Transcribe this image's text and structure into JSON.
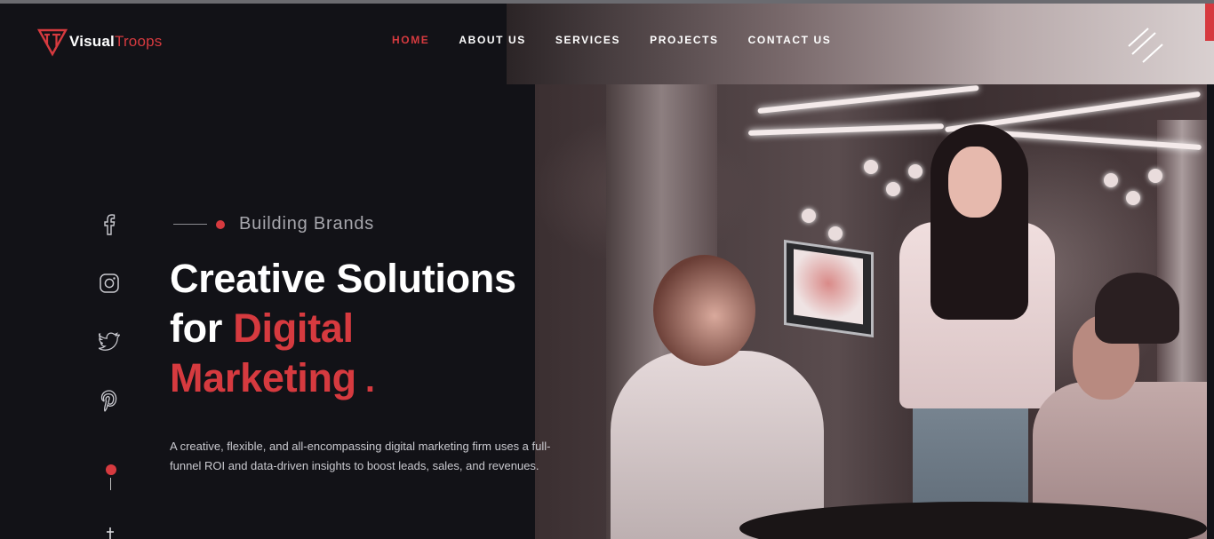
{
  "brand": {
    "name_part1": "Visual",
    "name_part2": "Troops"
  },
  "nav": {
    "items": [
      {
        "label": "HOME",
        "active": true
      },
      {
        "label": "ABOUT US",
        "active": false
      },
      {
        "label": "SERVICES",
        "active": false
      },
      {
        "label": "PROJECTS",
        "active": false
      },
      {
        "label": "CONTACT US",
        "active": false
      }
    ]
  },
  "hero": {
    "kicker": "Building Brands",
    "title_line1": "Creative Solutions",
    "title_line2_prefix": "for ",
    "title_line2_highlight": "Digital",
    "title_line3": "Marketing",
    "title_dot": ".",
    "description": "A creative, flexible, and all-encompassing digital marketing firm uses a full-funnel ROI and data-driven insights to boost leads, sales, and revenues."
  },
  "social": [
    {
      "icon": "facebook-icon"
    },
    {
      "icon": "instagram-icon"
    },
    {
      "icon": "twitter-icon"
    },
    {
      "icon": "pinterest-icon"
    }
  ],
  "colors": {
    "accent": "#d63a3f",
    "background": "#121217",
    "text": "#ffffff",
    "muted": "#a7a7ad"
  }
}
